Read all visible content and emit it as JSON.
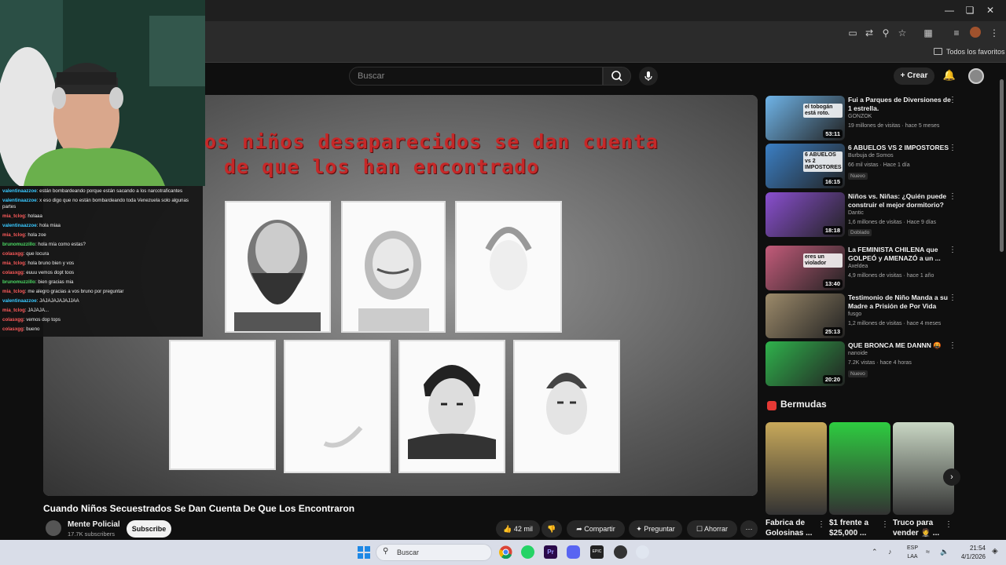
{
  "browser": {
    "bookmarks_label": "Todos los favoritos"
  },
  "youtube": {
    "search_placeholder": "Buscar",
    "create_label": "Crear"
  },
  "chat": [
    {
      "user": "valentinaazzoe",
      "msg": ": están bombardeando porque están sacando a los narcotraficantes",
      "color": "#39c8ff"
    },
    {
      "user": "valentinaazzoe",
      "msg": ": x eso digo que no están bombardeando toda Venezuela solo algunas partes",
      "color": "#39c8ff"
    },
    {
      "user": "mia_tclog",
      "msg": ": holaaa",
      "color": "#ff5b5b"
    },
    {
      "user": "valentinaazzoe",
      "msg": ": hola miaa",
      "color": "#39c8ff"
    },
    {
      "user": "mia_tclog",
      "msg": ": hola zoe",
      "color": "#ff5b5b"
    },
    {
      "user": "brunomuzzillo",
      "msg": ": hola mía como estas?",
      "color": "#4cd964"
    },
    {
      "user": "colasxgg",
      "msg": ": que locura",
      "color": "#ff5b5b"
    },
    {
      "user": "mia_tclog",
      "msg": ": hola bruno bien y vos",
      "color": "#ff5b5b"
    },
    {
      "user": "colasxgg",
      "msg": ": euuu vemos dopt toos",
      "color": "#ff5b5b"
    },
    {
      "user": "brunomuzzillo",
      "msg": ": bien gracias mia",
      "color": "#4cd964"
    },
    {
      "user": "mia_tclog",
      "msg": ": me alegro gracias a vos bruno por preguntar",
      "color": "#ff5b5b"
    },
    {
      "user": "valentinaazzoe",
      "msg": ": JAJAJAJAJAJJAA",
      "color": "#39c8ff"
    },
    {
      "user": "mia_tclog",
      "msg": ": JAJAJA...",
      "color": "#ff5b5b"
    },
    {
      "user": "colasxgg",
      "msg": ": vemos dop tops",
      "color": "#ff5b5b"
    },
    {
      "user": "colasxgg",
      "msg": ": bueno",
      "color": "#ff5b5b"
    }
  ],
  "video": {
    "overlay_line1": "os niños desaparecidos se dan cuenta",
    "overlay_line2": "de que los han encontrado",
    "title": "Cuando Niños Secuestrados Se Dan Cuenta De Que Los Encontraron",
    "channel": "Mente Policial",
    "subscribers": "17.7K subscribers",
    "subscribe_label": "Subscribe",
    "likes": "42 mil",
    "share_label": "Compartir",
    "ask_label": "Preguntar",
    "save_label": "Ahorrar"
  },
  "recommendations": [
    {
      "title": "Fui a Parques de Diversiones de 1 estrella.",
      "channel": "GONZOK",
      "meta": "19 millones de visitas · hace 5 meses",
      "duration": "53:11",
      "badge": "",
      "thumb_color": "#6fb4e8",
      "thumb_text": "el tobogán está roto."
    },
    {
      "title": "6 ABUELOS VS 2 IMPOSTORES",
      "channel": "Burbuja de Somos",
      "meta": "66 mil vistas · Hace 1 día",
      "duration": "16:15",
      "badge": "Nuevo",
      "thumb_color": "#3b7fc4",
      "thumb_text": "6 ABUELOS vs 2 IMPOSTORES"
    },
    {
      "title": "Niños vs. Niñas: ¿Quién puede construir el mejor dormitorio?",
      "channel": "Dantic",
      "meta": "1,6 millones de visitas · Hace 9 días",
      "duration": "18:18",
      "badge": "Doblado",
      "thumb_color": "#8a4fd0",
      "thumb_text": ""
    },
    {
      "title": "La FEMINISTA CHILENA que GOLPEÓ y AMENAZÓ a un ...",
      "channel": "Axeldea",
      "meta": "4,9 millones de visitas · hace 1 año",
      "duration": "13:40",
      "badge": "",
      "thumb_color": "#c35b7a",
      "thumb_text": "eres un violador"
    },
    {
      "title": "Testimonio de Niño Manda a su Madre a Prisión de Por Vida",
      "channel": "fusgo",
      "meta": "1,2 millones de visitas · hace 4 meses",
      "duration": "25:13",
      "badge": "",
      "thumb_color": "#9c8a6a",
      "thumb_text": ""
    },
    {
      "title": "QUE BRONCA ME DANNN 🤬",
      "channel": "nanoide",
      "meta": "7.2K vistas · hace 4 horas",
      "duration": "20:20",
      "badge": "Nuevo",
      "thumb_color": "#2fb24c",
      "thumb_text": ""
    }
  ],
  "shorts": {
    "header": "Bermudas",
    "items": [
      {
        "title": "Fabrica de Golosinas ...",
        "color": "#c8a95a"
      },
      {
        "title": "$1 frente a $25,000 ...",
        "color": "#2ecc40"
      },
      {
        "title": "Truco para vender 🤵 ...",
        "color": "#c9d7c4"
      }
    ]
  },
  "taskbar": {
    "search_placeholder": "Buscar",
    "lang1": "ESP",
    "lang2": "LAA",
    "time": "21:54",
    "date": "4/1/2026"
  }
}
